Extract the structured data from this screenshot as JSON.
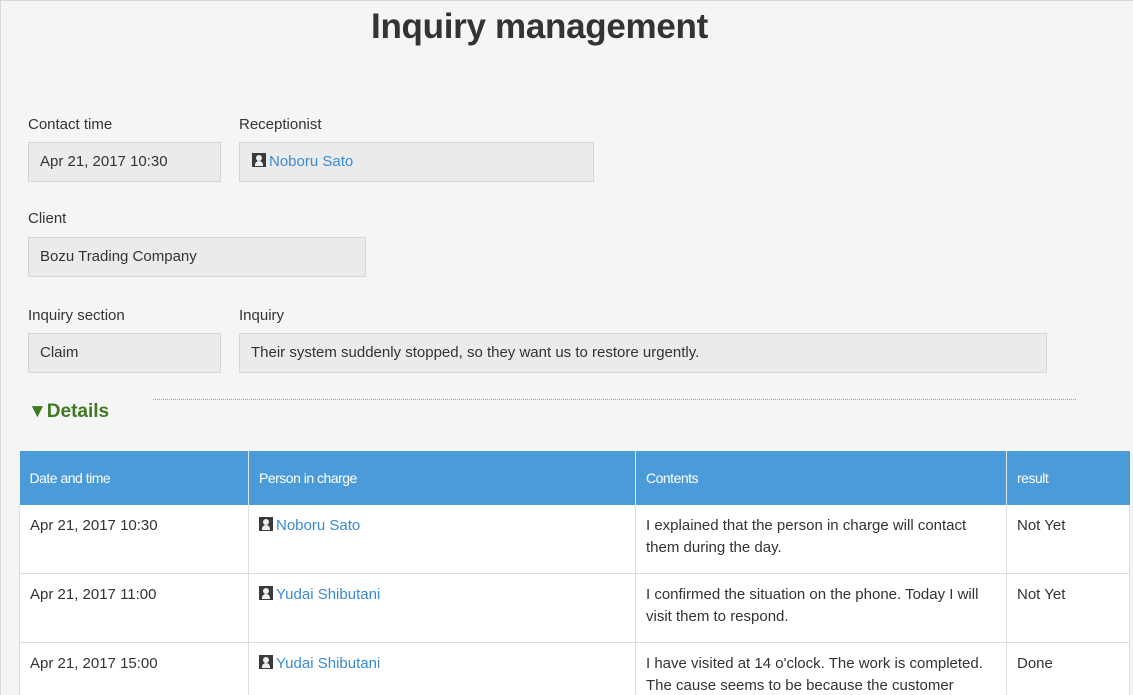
{
  "title": "Inquiry management",
  "form": {
    "contact_time": {
      "label": "Contact time",
      "value": "Apr 21, 2017 10:30"
    },
    "receptionist": {
      "label": "Receptionist",
      "value": "Noboru Sato",
      "icon": "user-icon"
    },
    "client": {
      "label": "Client",
      "value": "Bozu Trading Company"
    },
    "inquiry_section": {
      "label": "Inquiry section",
      "value": "Claim"
    },
    "inquiry": {
      "label": "Inquiry",
      "value": "Their system suddenly stopped, so they want us to restore urgently."
    }
  },
  "details": {
    "heading": "▼Details",
    "columns": [
      "Date and time",
      "Person in charge",
      "Contents",
      "result"
    ],
    "rows": [
      {
        "datetime": "Apr 21, 2017 10:30",
        "person": "Noboru Sato",
        "contents": "I explained that the person in charge will contact them during the day.",
        "result": "Not Yet"
      },
      {
        "datetime": "Apr 21, 2017 11:00",
        "person": "Yudai Shibutani",
        "contents": "I confirmed the situation on the phone. Today I will visit them to respond.",
        "result": "Not Yet"
      },
      {
        "datetime": "Apr 21, 2017 15:00",
        "person": "Yudai Shibutani",
        "contents": "I have visited at 14 o'clock. The work is completed. The cause seems to be because the customer",
        "result": "Done"
      }
    ]
  },
  "colors": {
    "header_blue": "#4c9bd9",
    "link_blue": "#3a8bd0",
    "details_green": "#3f7a22",
    "field_bg": "#ebebeb"
  }
}
